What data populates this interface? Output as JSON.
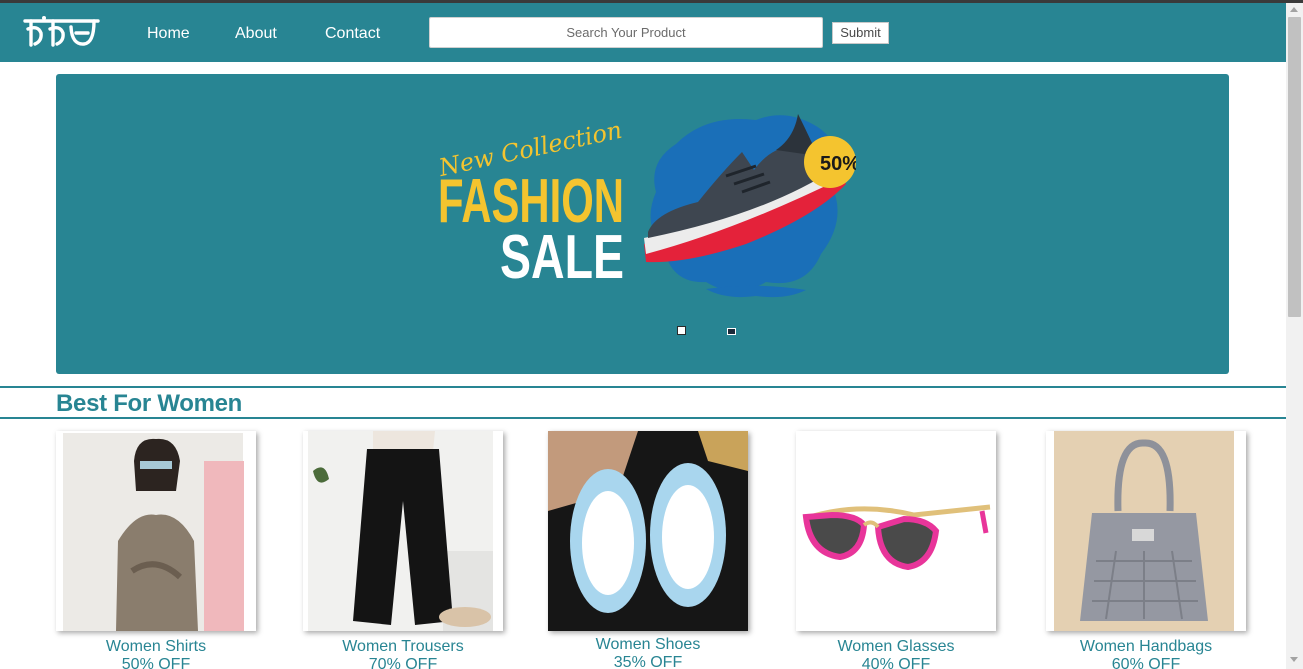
{
  "header": {
    "nav": {
      "home": "Home",
      "about": "About",
      "contact": "Contact"
    },
    "search": {
      "placeholder": "Search Your Product",
      "value": ""
    },
    "submit_label": "Submit"
  },
  "banner": {
    "line1": "New Collection",
    "line2": "FASHION",
    "line3": "SALE",
    "tag": "50%",
    "slides": 2
  },
  "section": {
    "title": "Best For Women"
  },
  "products": [
    {
      "name": "Women Shirts",
      "discount": "50% OFF"
    },
    {
      "name": "Women Trousers",
      "discount": "70% OFF"
    },
    {
      "name": "Women Shoes",
      "discount": "35% OFF"
    },
    {
      "name": "Women Glasses",
      "discount": "40% OFF"
    },
    {
      "name": "Women Handbags",
      "discount": "60% OFF"
    }
  ],
  "colors": {
    "brand_teal": "#288593",
    "sale_yellow": "#f4c42f",
    "shoe_red": "#e4223a",
    "splash_blue": "#1a6fb8"
  }
}
